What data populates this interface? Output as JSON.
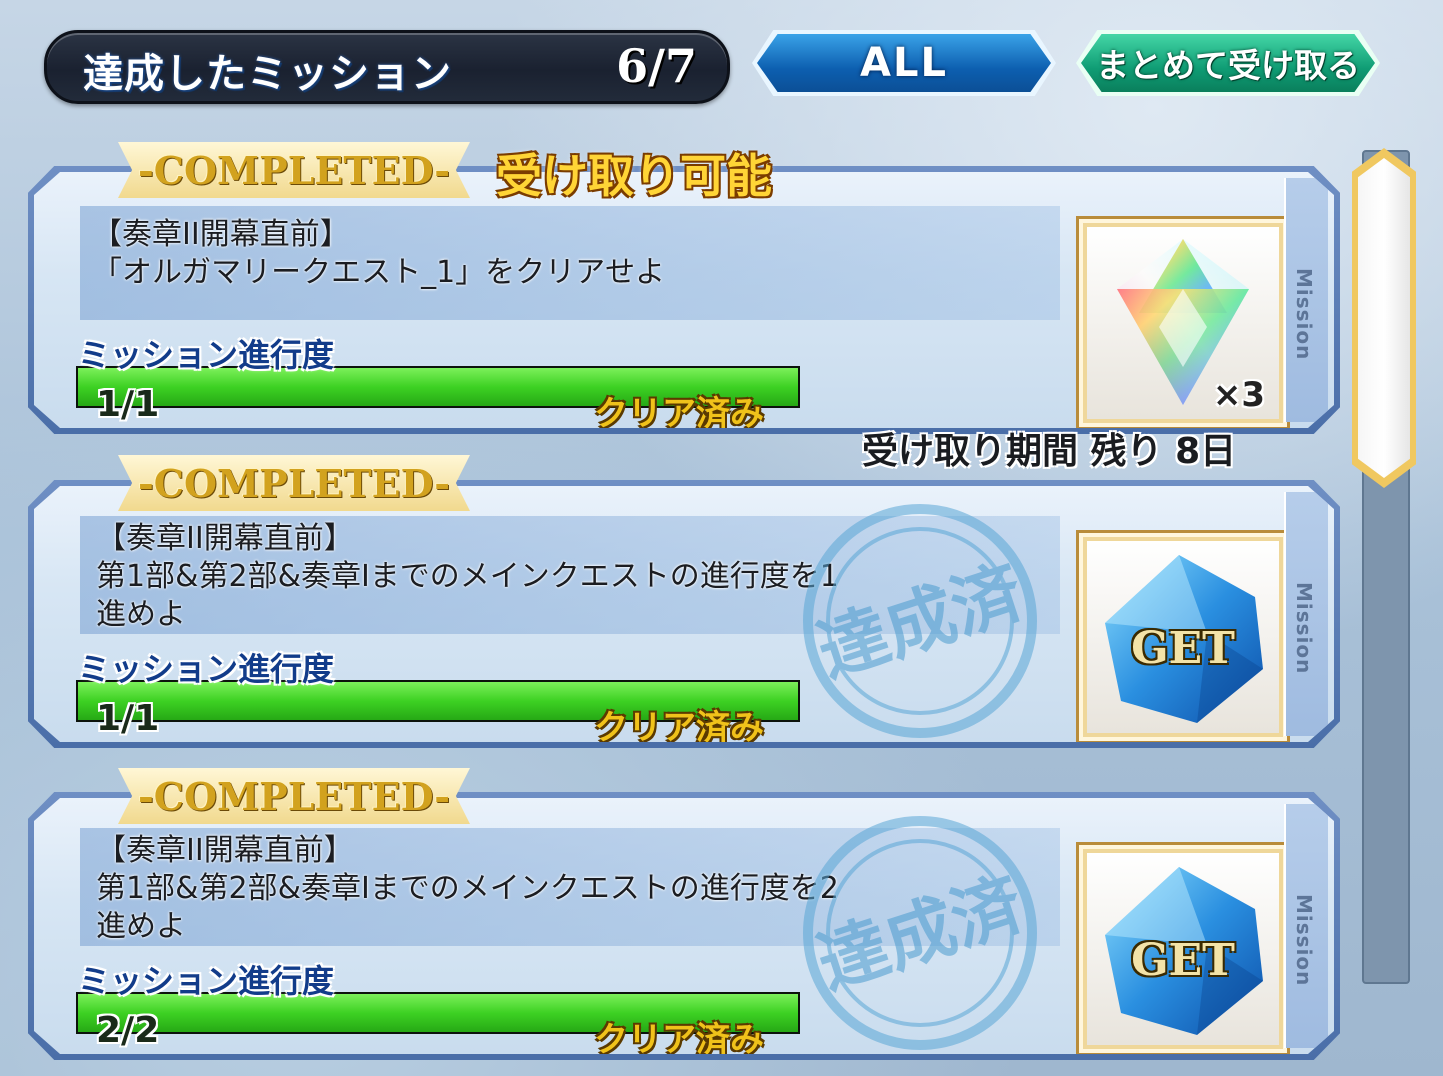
{
  "header": {
    "title": "達成したミッション",
    "count": "6/7",
    "filter_label": "ALL",
    "receive_all_label": "まとめて受け取る"
  },
  "missions": [
    {
      "ribbon": "-COMPLETED-",
      "status_note": "受け取り可能",
      "description": "【奏章II開幕直前】\n「オルガマリークエスト_1」をクリアせよ",
      "progress_label": "ミッション進行度",
      "progress_text": "1/1",
      "progress_fraction": 1.0,
      "clear_label": "クリア済み",
      "reward_icon": "rainbow-star-quartz-icon",
      "reward_qty": "×3",
      "deadline": "受け取り期間 残り 8日",
      "side_label": "Mission"
    },
    {
      "ribbon": "-COMPLETED-",
      "description": "【奏章II開幕直前】\n第1部&第2部&奏章Iまでのメインクエストの進行度を1\n進めよ",
      "progress_label": "ミッション進行度",
      "progress_text": "1/1",
      "progress_fraction": 1.0,
      "clear_label": "クリア済み",
      "reward_icon": "blue-crystal-get-icon",
      "reward_text": "GET",
      "stamp_text": "達成済",
      "side_label": "Mission"
    },
    {
      "ribbon": "-COMPLETED-",
      "description": "【奏章II開幕直前】\n第1部&第2部&奏章Iまでのメインクエストの進行度を2\n進めよ",
      "progress_label": "ミッション進行度",
      "progress_text": "2/2",
      "progress_fraction": 1.0,
      "clear_label": "クリア済み",
      "reward_icon": "blue-crystal-get-icon",
      "reward_text": "GET",
      "stamp_text": "達成済",
      "side_label": "Mission"
    }
  ],
  "colors": {
    "progress_green": "#3dd123",
    "ribbon_gold": "#d2a21e",
    "filter_blue": "#0d5fb0",
    "receive_green": "#0f9c74"
  }
}
